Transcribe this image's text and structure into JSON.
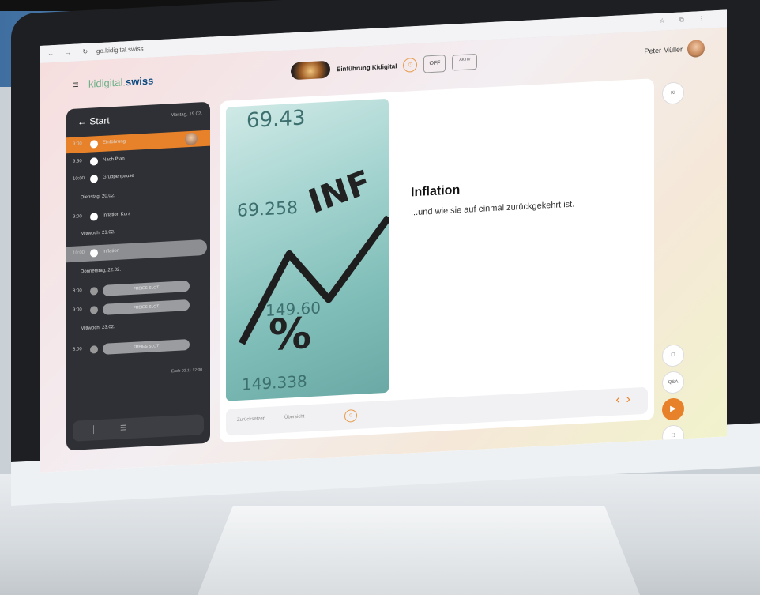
{
  "banner": {
    "text": ""
  },
  "browser": {
    "nav_glyphs": "← → ↻",
    "url": "go.kidigital.swiss",
    "tools": "☆ ⧉ ⋮"
  },
  "app": {
    "menu_icon": "≡",
    "logo_part1": "kidigital.",
    "logo_part2": "swiss",
    "header": {
      "lesson_title": "Einführung Kidigital",
      "off_label": "OFF",
      "mode_label": "AKTIV"
    },
    "user": {
      "name": "Peter Müller"
    }
  },
  "sidebar": {
    "heading": "← Start",
    "date": "Montag, 19.02.",
    "rows": [
      {
        "time": "9:00",
        "label": "Einführung",
        "state": "active"
      },
      {
        "time": "9:30",
        "label": "Nach Plan",
        "state": "done"
      },
      {
        "time": "10:00",
        "label": "Gruppenpause",
        "state": "done"
      },
      {
        "day": "Dienstag, 20.02."
      },
      {
        "time": "9:00",
        "label": "Inflation Kurs",
        "state": "done"
      },
      {
        "day": "Mittwoch, 21.02."
      },
      {
        "time": "10:00",
        "label": "Inflation",
        "state": "selected"
      },
      {
        "day": "Donnerstag, 22.02."
      },
      {
        "time": "8:00",
        "pill": "FREIES SLOT",
        "state": "free"
      },
      {
        "time": "9:00",
        "pill": "FREIES SLOT",
        "state": "free"
      },
      {
        "day": "Mittwoch, 23.02."
      },
      {
        "time": "8:00",
        "pill": "FREIES SLOT",
        "state": "free"
      }
    ],
    "end_label": "Ende 02.11 12:00",
    "bottom_icons": [
      "│",
      "☰"
    ]
  },
  "slide": {
    "image_numbers": [
      "69.43",
      "69.258",
      "149.60",
      "149.338"
    ],
    "image_word": "INF",
    "image_percent": "%",
    "title": "Inflation",
    "subtitle": "...und wie sie auf einmal zurückgekehrt ist."
  },
  "footer": {
    "item1": "Zurücksetzen",
    "item2": "Übersicht",
    "item3": "⏱",
    "prev": "‹",
    "next": "›"
  },
  "rail": {
    "top": "KI",
    "chat": "☐",
    "qa": "Q&A",
    "play": "▶",
    "fullscreen": "⛶"
  }
}
